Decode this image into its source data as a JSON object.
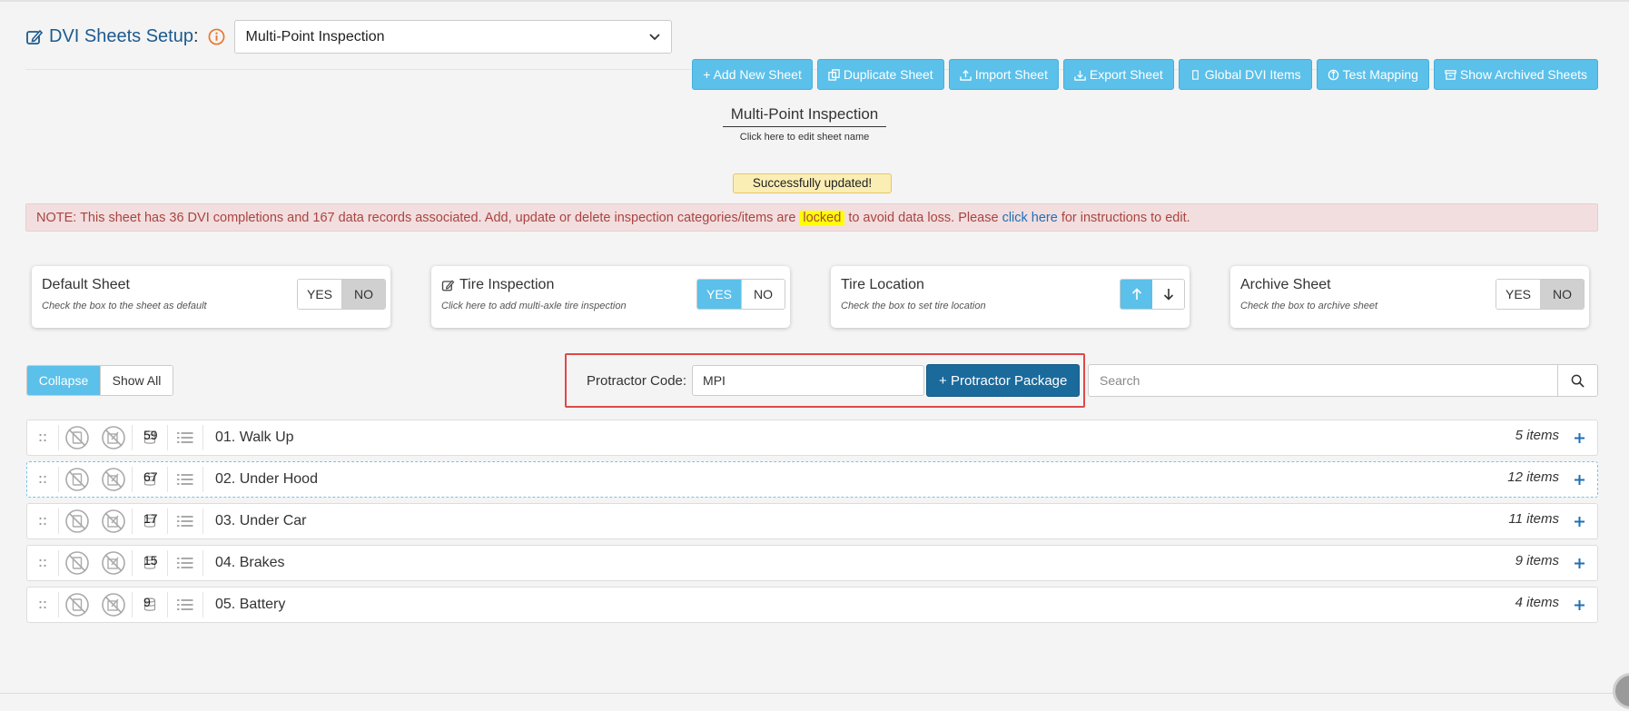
{
  "header": {
    "title": "DVI Sheets Setup",
    "colon": ":",
    "selected_sheet": "Multi-Point Inspection"
  },
  "toolbar": {
    "buttons": [
      {
        "label": "+ Add New Sheet",
        "icon": "plus-icon"
      },
      {
        "label": "Duplicate Sheet",
        "icon": "copy-icon"
      },
      {
        "label": "Import Sheet",
        "icon": "upload-icon"
      },
      {
        "label": "Export Sheet",
        "icon": "download-icon"
      },
      {
        "label": "Global DVI Items",
        "icon": "box-icon"
      },
      {
        "label": "Test Mapping",
        "icon": "mapping-icon"
      },
      {
        "label": "Show Archived Sheets",
        "icon": "archive-icon"
      }
    ]
  },
  "sheet": {
    "name": "Multi-Point Inspection",
    "hint": "Click here to edit sheet name"
  },
  "status": {
    "message": "Successfully updated!"
  },
  "note": {
    "part1": "NOTE: This sheet has 36 DVI completions and 167 data records associated. Add, update or delete inspection categories/items are",
    "locked": "locked",
    "part2": "to avoid data loss. Please",
    "link": "click here",
    "part3": "for instructions to edit."
  },
  "settings": {
    "default_sheet": {
      "title": "Default Sheet",
      "subtitle": "Check the box to the sheet as default",
      "yes": "YES",
      "no": "NO",
      "value": "NO"
    },
    "tire_inspection": {
      "title": "Tire Inspection",
      "subtitle": "Click here to add multi-axle tire inspection",
      "yes": "YES",
      "no": "NO",
      "value": "YES"
    },
    "tire_location": {
      "title": "Tire Location",
      "subtitle": "Check the box to set tire location",
      "value": "up"
    },
    "archive_sheet": {
      "title": "Archive Sheet",
      "subtitle": "Check the box to archive sheet",
      "yes": "YES",
      "no": "NO",
      "value": "NO"
    }
  },
  "controls": {
    "collapse": "Collapse",
    "show_all": "Show All",
    "protractor_label": "Protractor Code:",
    "protractor_value": "MPI",
    "protractor_button": "+ Protractor Package",
    "search_placeholder": "Search"
  },
  "categories": [
    {
      "name": "01. Walk Up",
      "count": "59",
      "items": "5 items"
    },
    {
      "name": "02. Under Hood",
      "count": "67",
      "items": "12 items"
    },
    {
      "name": "03. Under Car",
      "count": "17",
      "items": "11 items"
    },
    {
      "name": "04. Brakes",
      "count": "15",
      "items": "9 items"
    },
    {
      "name": "05. Battery",
      "count": "9",
      "items": "4 items"
    }
  ],
  "colors": {
    "accent": "#5bc0ea",
    "dark_accent": "#1b6a9c",
    "title": "#1c5a8e",
    "alert_bg": "#f2dede",
    "alert_text": "#a94442",
    "highlight": "#e04848"
  }
}
